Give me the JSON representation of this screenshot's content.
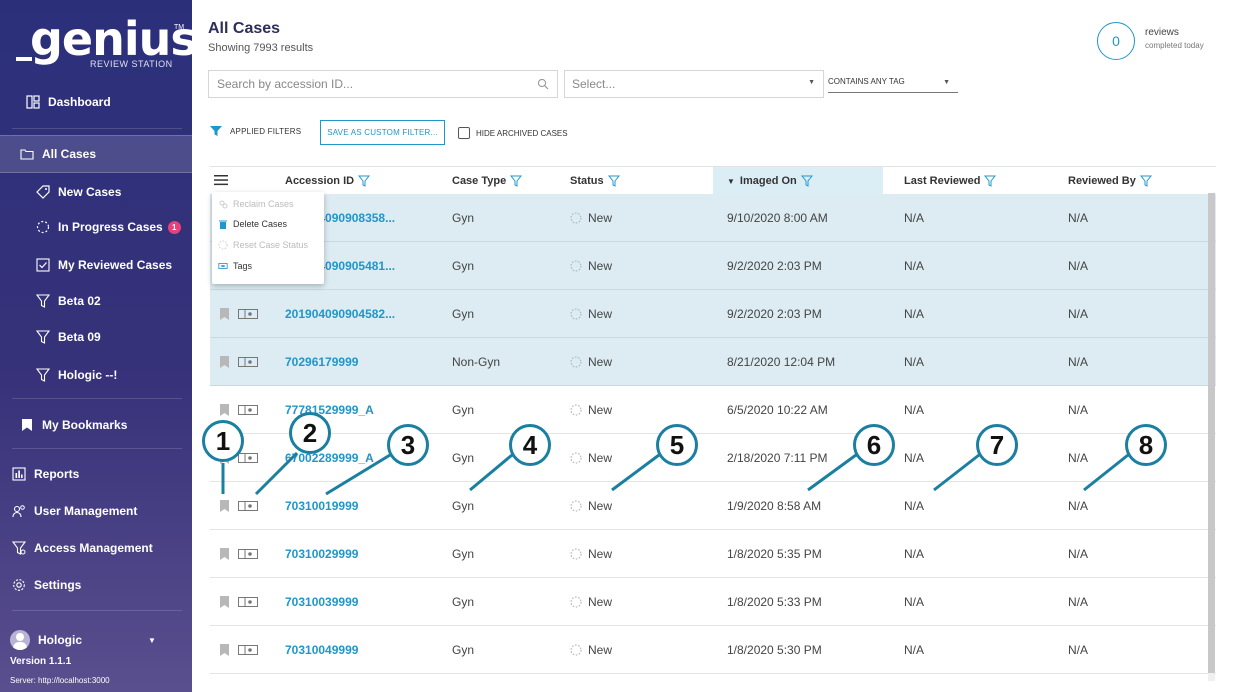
{
  "sidebar": {
    "logo_word": "genius",
    "logo_tm": "TM",
    "logo_sub": "REVIEW STATION",
    "dashboard": "Dashboard",
    "all_cases": "All Cases",
    "new_cases": "New Cases",
    "in_progress": "In Progress Cases",
    "in_progress_badge": "1",
    "my_reviewed": "My Reviewed Cases",
    "beta02": "Beta 02",
    "beta09": "Beta 09",
    "hologic_filter": "Hologic --!",
    "bookmarks": "My Bookmarks",
    "reports": "Reports",
    "user_mgmt": "User Management",
    "access_mgmt": "Access Management",
    "settings": "Settings",
    "user_name": "Hologic",
    "version": "Version 1.1.1",
    "server": "Server: http://localhost:3000"
  },
  "header": {
    "title": "All Cases",
    "results": "Showing 7993 results",
    "reviews_count": "0",
    "reviews_label": "reviews",
    "reviews_sub": "completed today"
  },
  "filters": {
    "search_placeholder": "Search by accession ID...",
    "select_placeholder": "Select...",
    "tag_mode": "CONTAINS ANY TAG",
    "applied": "APPLIED FILTERS",
    "save_custom": "SAVE AS CUSTOM FILTER...",
    "hide_archived": "HIDE ARCHIVED CASES"
  },
  "columns": {
    "accession": "Accession ID",
    "case_type": "Case Type",
    "status": "Status",
    "imaged_on": "Imaged On",
    "last_reviewed": "Last Reviewed",
    "reviewed_by": "Reviewed By"
  },
  "context_menu": {
    "reclaim": "Reclaim Cases",
    "delete": "Delete Cases",
    "reset": "Reset Case Status",
    "tags": "Tags"
  },
  "rows": [
    {
      "accession": "2019040909083­58...",
      "case_type": "Gyn",
      "status": "New",
      "imaged_on": "9/10/2020 8:00 AM",
      "last_reviewed": "N/A",
      "reviewed_by": "N/A",
      "selected": true
    },
    {
      "accession": "201904090905481...",
      "case_type": "Gyn",
      "status": "New",
      "imaged_on": "9/2/2020 2:03 PM",
      "last_reviewed": "N/A",
      "reviewed_by": "N/A",
      "selected": true
    },
    {
      "accession": "201904090904582...",
      "case_type": "Gyn",
      "status": "New",
      "imaged_on": "9/2/2020 2:03 PM",
      "last_reviewed": "N/A",
      "reviewed_by": "N/A",
      "selected": true
    },
    {
      "accession": "70296179999",
      "case_type": "Non-Gyn",
      "status": "New",
      "imaged_on": "8/21/2020 12:04 PM",
      "last_reviewed": "N/A",
      "reviewed_by": "N/A",
      "selected": true
    },
    {
      "accession": "77781529999_A",
      "case_type": "Gyn",
      "status": "New",
      "imaged_on": "6/5/2020 10:22 AM",
      "last_reviewed": "N/A",
      "reviewed_by": "N/A",
      "selected": false
    },
    {
      "accession": "67002289999_A",
      "case_type": "Gyn",
      "status": "New",
      "imaged_on": "2/18/2020 7:11 PM",
      "last_reviewed": "N/A",
      "reviewed_by": "N/A",
      "selected": false
    },
    {
      "accession": "70310019999",
      "case_type": "Gyn",
      "status": "New",
      "imaged_on": "1/9/2020 8:58 AM",
      "last_reviewed": "N/A",
      "reviewed_by": "N/A",
      "selected": false
    },
    {
      "accession": "70310029999",
      "case_type": "Gyn",
      "status": "New",
      "imaged_on": "1/8/2020 5:35 PM",
      "last_reviewed": "N/A",
      "reviewed_by": "N/A",
      "selected": false
    },
    {
      "accession": "70310039999",
      "case_type": "Gyn",
      "status": "New",
      "imaged_on": "1/8/2020 5:33 PM",
      "last_reviewed": "N/A",
      "reviewed_by": "N/A",
      "selected": false
    },
    {
      "accession": "70310049999",
      "case_type": "Gyn",
      "status": "New",
      "imaged_on": "1/8/2020 5:30 PM",
      "last_reviewed": "N/A",
      "reviewed_by": "N/A",
      "selected": false
    }
  ],
  "callouts": [
    "1",
    "2",
    "3",
    "4",
    "5",
    "6",
    "7",
    "8"
  ],
  "colors": {
    "accent": "#2196c9",
    "callout_ring": "#1a7fa0",
    "selected_row": "#dcecf2",
    "badge": "#e8417a"
  }
}
